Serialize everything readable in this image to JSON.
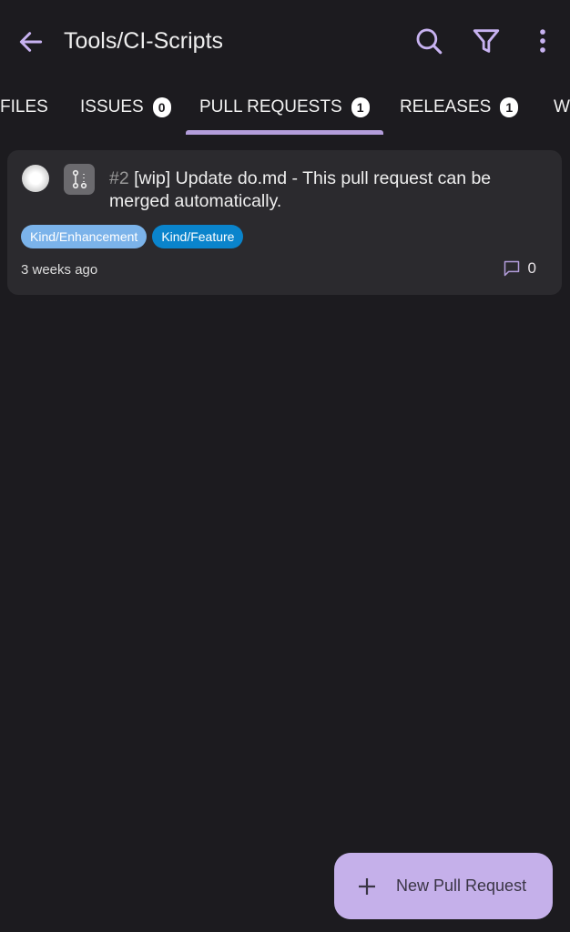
{
  "header": {
    "title": "Tools/CI-Scripts",
    "back_icon": "arrow-left-icon",
    "search_icon": "search-icon",
    "filter_icon": "filter-icon",
    "menu_icon": "more-vert-icon"
  },
  "tabs": [
    {
      "label": "FILES"
    },
    {
      "label": "ISSUES",
      "count": "0"
    },
    {
      "label": "PULL REQUESTS",
      "count": "1",
      "active": true
    },
    {
      "label": "RELEASES",
      "count": "1"
    },
    {
      "label": "W"
    }
  ],
  "pull_requests": [
    {
      "number": "#2",
      "title": "[wip] Update do.md - This pull request can be merged automatically.",
      "labels": [
        {
          "name": "Kind/Enhancement",
          "color": "#7bb3ea"
        },
        {
          "name": "Kind/Feature",
          "color": "#0a84cc"
        }
      ],
      "time": "3 weeks ago",
      "comments": "0"
    }
  ],
  "fab": {
    "label": "New Pull Request"
  },
  "colors": {
    "accent": "#b39ddb",
    "background": "#1c1b1f",
    "card": "#2b2a2e"
  }
}
